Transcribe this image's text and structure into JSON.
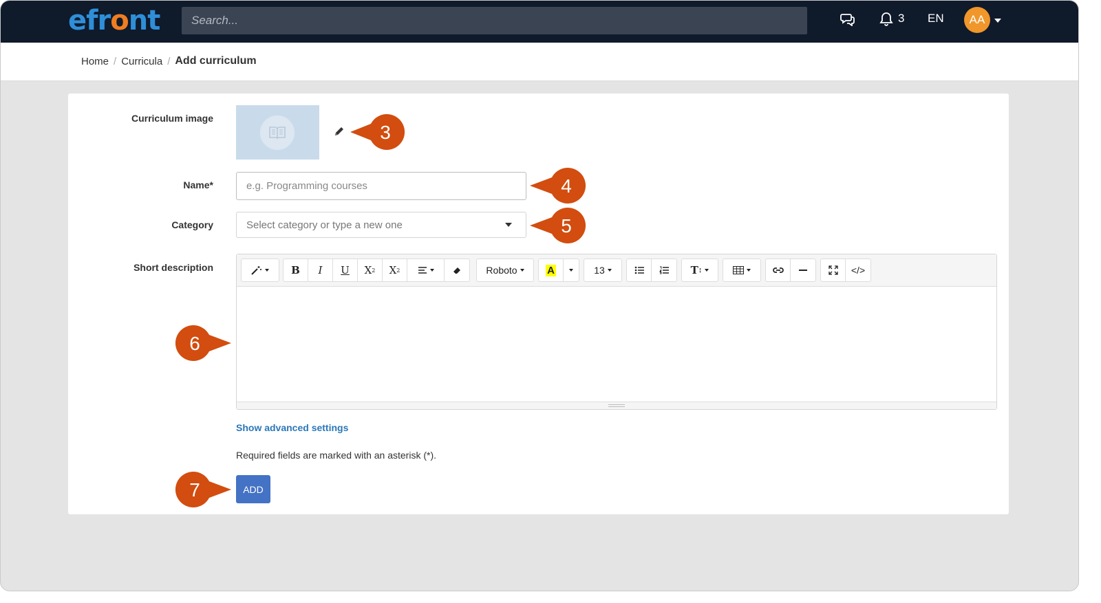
{
  "topbar": {
    "logo": {
      "pre": "efr",
      "o": "o",
      "post": "nt"
    },
    "search_placeholder": "Search...",
    "notification_count": "3",
    "language": "EN",
    "avatar_initials": "AA"
  },
  "breadcrumb": {
    "items": [
      "Home",
      "Curricula"
    ],
    "current": "Add curriculum"
  },
  "form": {
    "image_label": "Curriculum image",
    "name_label": "Name*",
    "name_placeholder": "e.g. Programming courses",
    "category_label": "Category",
    "category_placeholder": "Select category or type a new one",
    "description_label": "Short description",
    "font_name": "Roboto",
    "font_size": "13",
    "advanced_link": "Show advanced settings",
    "required_note": "Required fields are marked with an asterisk (*).",
    "add_button": "ADD"
  },
  "callouts": [
    "3",
    "4",
    "5",
    "6",
    "7"
  ],
  "colors": {
    "callout": "#d24d0f",
    "topbar": "#0f1a2b",
    "primary": "#4472c4",
    "link": "#2a77b8",
    "avatar": "#f0962a"
  }
}
